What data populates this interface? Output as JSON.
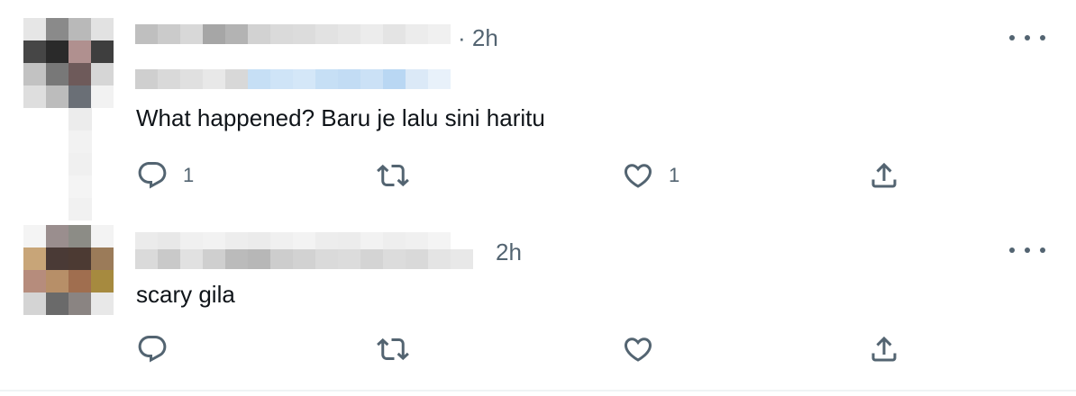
{
  "tweets": [
    {
      "time": "· 2h",
      "text": "What happened? Baru je lalu sini haritu",
      "reply_count": "1",
      "like_count": "1",
      "avatar_colors": [
        "#e6e6e6",
        "#8a8a8a",
        "#b9b9b9",
        "#e2e2e2",
        "#464646",
        "#2a2a2a",
        "#b0908f",
        "#3e3e3e",
        "#c2c2c2",
        "#787878",
        "#6e5a5a",
        "#d6d6d6",
        "#dedede",
        "#bcbcbc",
        "#6a6f76",
        "#f2f2f2"
      ],
      "name_colors": [
        "#bfbfbf",
        "#cbcbcb",
        "#d8d8d8",
        "#a6a6a6",
        "#b3b3b3",
        "#d2d2d2",
        "#dadada",
        "#dcdcdc",
        "#e2e2e2",
        "#e6e6e6",
        "#ececec",
        "#e4e4e4",
        "#ececec",
        "#f0f0f0"
      ],
      "handle_colors": [
        "#cfcfcf",
        "#d9d9d9",
        "#e0e0e0",
        "#e8e8e8",
        "#d8d8d8",
        "#c6dff5",
        "#cfe4f7",
        "#d4e7f8",
        "#c6dff5",
        "#c2dcf4",
        "#cbe1f6",
        "#b9d7f3",
        "#dbe9f7",
        "#e8f1fa"
      ],
      "thread_colors": [
        "#ececec",
        "#f2f2f2",
        "#f0f0f0",
        "#f4f4f4",
        "#f1f1f1"
      ]
    },
    {
      "time": "2h",
      "text": "scary gila",
      "reply_count": "",
      "like_count": "",
      "avatar_colors": [
        "#f4f4f4",
        "#9a8e8e",
        "#8c8c86",
        "#f3f3f3",
        "#c8a578",
        "#4a3a36",
        "#4c3a33",
        "#9b7b59",
        "#b68c7c",
        "#b78f68",
        "#a06e4f",
        "#a68a3f",
        "#d4d4d4",
        "#6a6a6a",
        "#8a8482",
        "#e8e8e8"
      ],
      "name_colors": [
        "#ebebeb",
        "#e8e8e8",
        "#f0f0f0",
        "#f2f2f2",
        "#ededed",
        "#ebebeb",
        "#f0f0f0",
        "#f3f3f3",
        "#ededed",
        "#ececec",
        "#f2f2f2",
        "#eeeeee",
        "#f0f0f0",
        "#f4f4f4"
      ],
      "name2_colors": [
        "#dadada",
        "#c9c9c9",
        "#e1e1e1",
        "#cfcfcf",
        "#bbbbbb",
        "#b7b7b7",
        "#cdcdcd",
        "#d2d2d2",
        "#dadada",
        "#dcdcdc",
        "#d4d4d4",
        "#dcdcdc",
        "#d9d9d9",
        "#e4e4e4",
        "#e8e8e8"
      ]
    }
  ],
  "colors": {
    "text_primary": "#0f1419",
    "text_secondary": "#536471",
    "border": "#eff3f4"
  },
  "icons": [
    "reply-icon",
    "retweet-icon",
    "like-icon",
    "share-icon",
    "more-icon"
  ]
}
